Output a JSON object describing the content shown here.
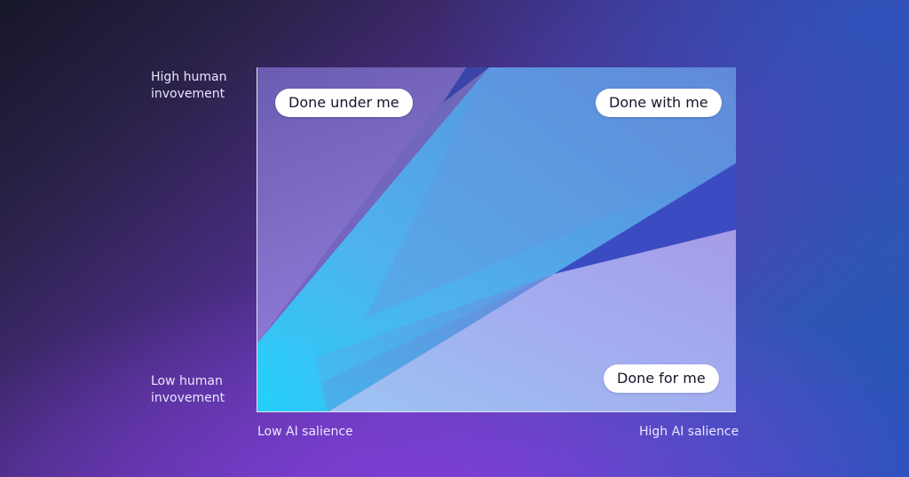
{
  "axes": {
    "y_high": [
      "High human",
      "invovement"
    ],
    "y_low": [
      "Low human",
      "invovement"
    ],
    "x_low": "Low AI salience",
    "x_high": "High AI salience"
  },
  "regions": {
    "done_under_me": "Done under me",
    "done_with_me": "Done with me",
    "done_for_me": "Done for me"
  },
  "colors": {
    "cyan": "#22d0f8",
    "light_blue": "#8fb8f0",
    "lavender": "#a9a8ec",
    "deep_blue": "#3d4fc4"
  }
}
